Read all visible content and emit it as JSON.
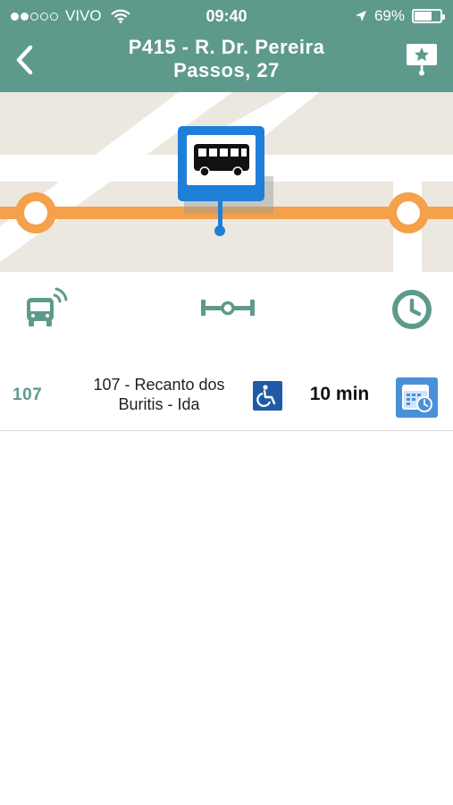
{
  "status_bar": {
    "carrier": "VIVO",
    "time": "09:40",
    "battery_percent": "69%",
    "battery_level": 0.69,
    "signal_filled": 2,
    "signal_total": 5
  },
  "header": {
    "title_line1": "P415 - R. Dr. Pereira",
    "title_line2": "Passos, 27",
    "back_icon": "chevron-left-icon",
    "favorite_icon": "star-pin-icon"
  },
  "colors": {
    "header_bg": "#5e9a8c",
    "route_line": "#f5a04a",
    "map_bg": "#ece7df",
    "bus_stop_blue": "#1f7fd8",
    "accent": "#5e9a8c",
    "wheelchair_blue": "#1f5aa6",
    "schedule_blue": "#4a90d9"
  },
  "toolbar": {
    "items": [
      {
        "icon": "realtime-bus-icon"
      },
      {
        "icon": "route-line-icon"
      },
      {
        "icon": "clock-icon"
      }
    ]
  },
  "lines": [
    {
      "number": "107",
      "name": "107 - Recanto dos Buritis - Ida",
      "accessible": true,
      "arrival": "10 min"
    }
  ]
}
